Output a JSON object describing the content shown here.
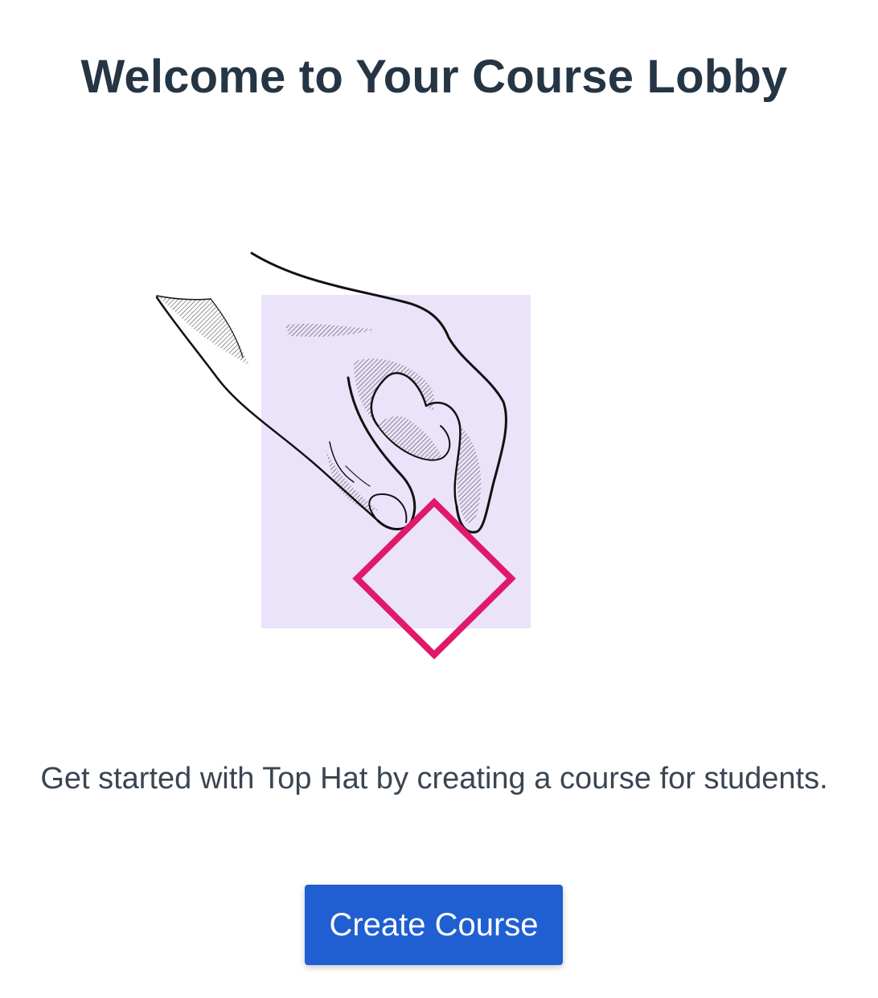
{
  "lobby": {
    "title": "Welcome to Your Course Lobby",
    "subtitle": "Get started with Top Hat by creating a course for students.",
    "create_button_label": "Create Course"
  },
  "illustration": {
    "icon": "hand-holding-diamond-icon",
    "background_color": "#ebe3fa",
    "diamond_color": "#e0196a"
  },
  "colors": {
    "button": "#1f5fd1",
    "title": "#263544",
    "text": "#3a4553"
  }
}
